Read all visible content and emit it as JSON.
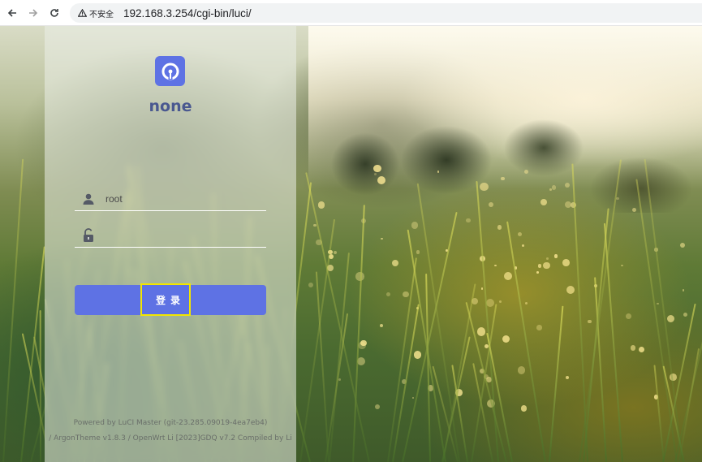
{
  "browser": {
    "back_icon": "arrow-left-icon",
    "forward_icon": "arrow-right-icon",
    "reload_icon": "reload-icon",
    "security_label": "不安全",
    "url": "192.168.3.254/cgi-bin/luci/"
  },
  "login": {
    "brand": "none",
    "username_value": "root",
    "password_value": "",
    "user_icon": "user-icon",
    "lock_icon": "lock-icon",
    "submit_label": "登录"
  },
  "footer": {
    "line1": "Powered by LuCI Master (git-23.285.09019-4ea7eb4)",
    "line2": "/ ArgonTheme v1.8.3 / OpenWrt Li [2023]GDQ v7.2 Compiled by Li"
  },
  "colors": {
    "accent": "#5e72e4",
    "highlight": "#f2e600"
  }
}
